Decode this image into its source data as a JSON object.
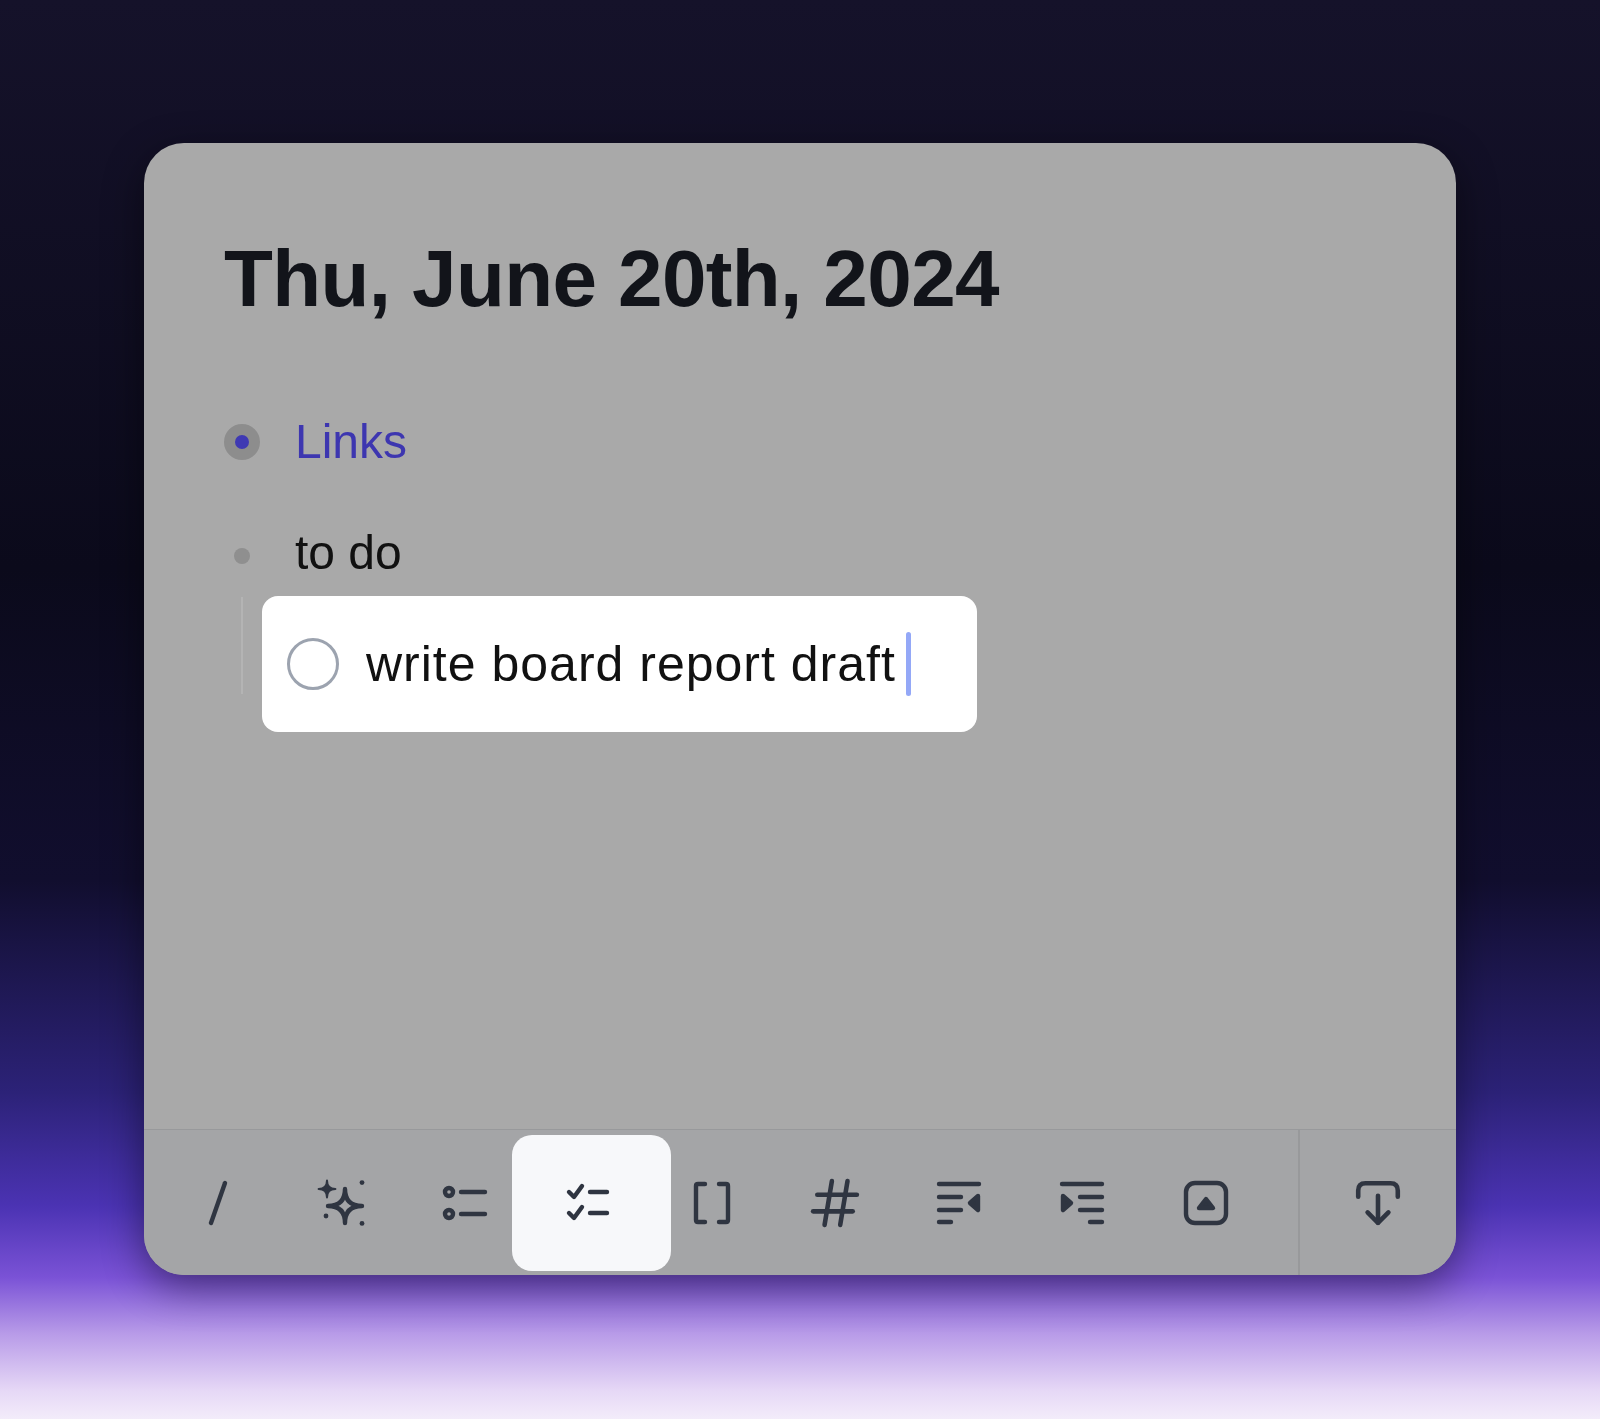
{
  "note": {
    "title": "Thu, June 20th, 2024",
    "blocks": [
      {
        "kind": "page-link",
        "text": "Links",
        "collapsed": true,
        "selected": false
      },
      {
        "kind": "text",
        "text": "to do",
        "collapsed": false,
        "selected": false,
        "children": [
          {
            "kind": "task",
            "text": "write board report draft",
            "checked": false,
            "selected": true
          }
        ]
      }
    ]
  },
  "toolbar": {
    "buttons": [
      {
        "kind": "slash",
        "selected": false
      },
      {
        "kind": "sparkles",
        "selected": false
      },
      {
        "kind": "bullet-list",
        "selected": false
      },
      {
        "kind": "checklist",
        "selected": true
      },
      {
        "kind": "brackets",
        "selected": false
      },
      {
        "kind": "hash",
        "selected": false
      },
      {
        "kind": "outdent",
        "selected": false
      },
      {
        "kind": "indent",
        "selected": false
      },
      {
        "kind": "triangle-box",
        "selected": false
      }
    ],
    "end_button": {
      "kind": "download",
      "selected": false
    }
  }
}
